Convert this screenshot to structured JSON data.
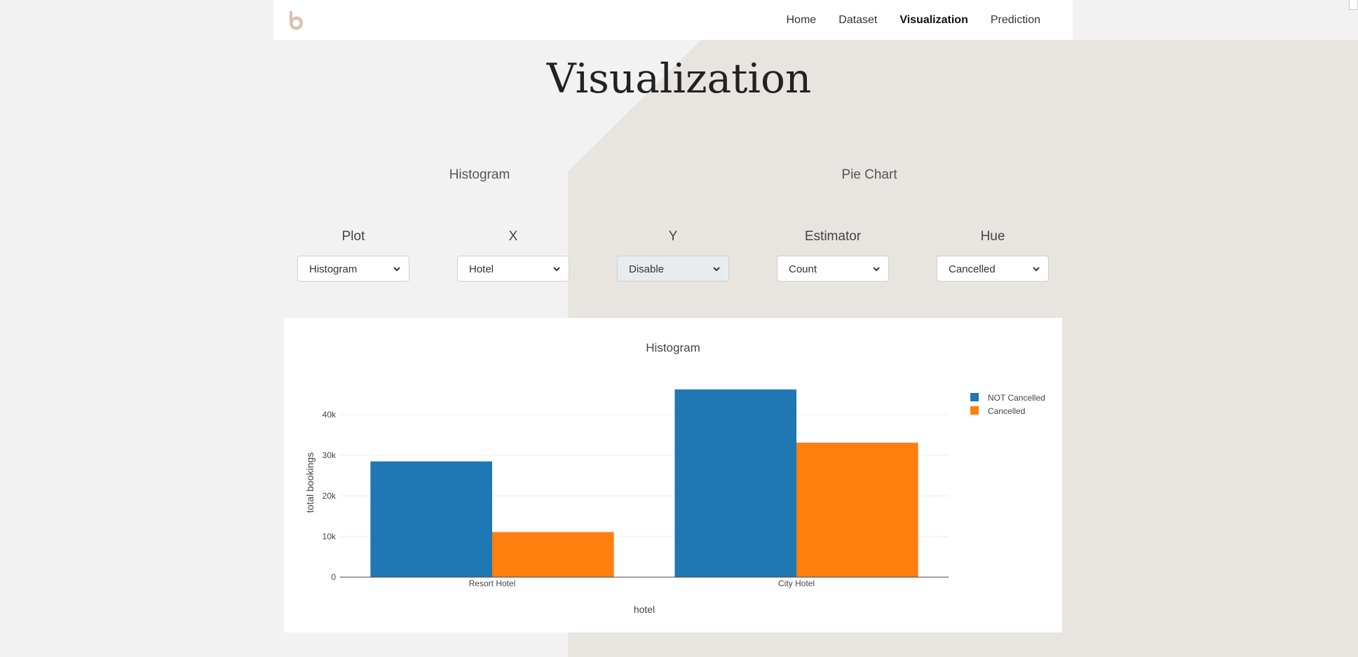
{
  "nav": {
    "links": [
      {
        "label": "Home",
        "active": false
      },
      {
        "label": "Dataset",
        "active": false
      },
      {
        "label": "Visualization",
        "active": true
      },
      {
        "label": "Prediction",
        "active": false
      }
    ]
  },
  "page": {
    "title": "Visualization"
  },
  "sections": {
    "histogram": "Histogram",
    "pie_chart": "Pie Chart"
  },
  "controls": [
    {
      "label": "Plot",
      "value": "Histogram",
      "disabled": false
    },
    {
      "label": "X",
      "value": "Hotel",
      "disabled": false
    },
    {
      "label": "Y",
      "value": "Disable",
      "disabled": true
    },
    {
      "label": "Estimator",
      "value": "Count",
      "disabled": false
    },
    {
      "label": "Hue",
      "value": "Cancelled",
      "disabled": false
    }
  ],
  "colors": {
    "accent_logo": "#dcc0b0",
    "series_not_cancelled": "#1f77b4",
    "series_cancelled": "#ff7f0e",
    "bg_left": "#f2f2f2",
    "bg_right": "#e8e4e0"
  },
  "icons": {
    "logo": "b-logo",
    "select_arrow": "chevron-down-icon"
  },
  "chart_data": {
    "type": "bar",
    "title": "Histogram",
    "xlabel": "hotel",
    "ylabel": "total bookings",
    "categories": [
      "Resort Hotel",
      "City Hotel"
    ],
    "series": [
      {
        "name": "NOT Cancelled",
        "values": [
          28500,
          46200
        ]
      },
      {
        "name": "Cancelled",
        "values": [
          11100,
          33100
        ]
      }
    ],
    "ylim": [
      0,
      50000
    ],
    "yticks": [
      0,
      10000,
      20000,
      30000,
      40000
    ],
    "ytick_labels": [
      "0",
      "10k",
      "20k",
      "30k",
      "40k"
    ],
    "grid": true,
    "legend": "top-right"
  }
}
